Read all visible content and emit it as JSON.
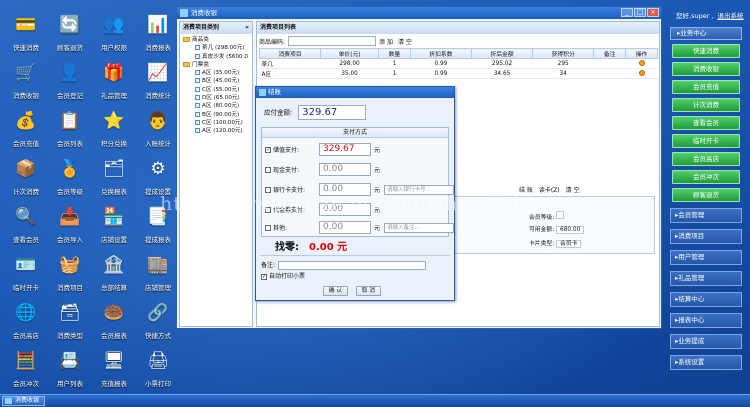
{
  "desktop": {
    "icons": [
      {
        "label": "快速消费",
        "glyph": "💳",
        "icon": "card-icon"
      },
      {
        "label": "顾客退货",
        "glyph": "🔄",
        "icon": "return-icon"
      },
      {
        "label": "用户权限",
        "glyph": "👥",
        "icon": "users-icon"
      },
      {
        "label": "消费报表",
        "glyph": "📊",
        "icon": "report-icon"
      },
      {
        "label": "消费收银",
        "glyph": "🛒",
        "icon": "cashier-icon"
      },
      {
        "label": "会员登记",
        "glyph": "👤",
        "icon": "member-register-icon"
      },
      {
        "label": "礼品管理",
        "glyph": "🎁",
        "icon": "gift-icon"
      },
      {
        "label": "消费统计",
        "glyph": "📈",
        "icon": "stats-icon"
      },
      {
        "label": "会员充值",
        "glyph": "💰",
        "icon": "recharge-icon"
      },
      {
        "label": "会员列表",
        "glyph": "📋",
        "icon": "member-list-icon"
      },
      {
        "label": "积分兑换",
        "glyph": "⭐",
        "icon": "points-icon"
      },
      {
        "label": "入账统计",
        "glyph": "👨",
        "icon": "income-icon"
      },
      {
        "label": "计次消费",
        "glyph": "📦",
        "icon": "count-icon"
      },
      {
        "label": "会员等级",
        "glyph": "🏅",
        "icon": "level-icon"
      },
      {
        "label": "兑换报表",
        "glyph": "🗂",
        "icon": "exchange-report-icon"
      },
      {
        "label": "提成设置",
        "glyph": "⚙",
        "icon": "settings-icon"
      },
      {
        "label": "查看会员",
        "glyph": "🔍",
        "icon": "view-member-icon"
      },
      {
        "label": "会员导入",
        "glyph": "📥",
        "icon": "import-icon"
      },
      {
        "label": "店铺设置",
        "glyph": "🏪",
        "icon": "shop-icon"
      },
      {
        "label": "提成报表",
        "glyph": "📑",
        "icon": "commission-icon"
      },
      {
        "label": "临时开卡",
        "glyph": "🪪",
        "icon": "temp-card-icon"
      },
      {
        "label": "消费项目",
        "glyph": "🧺",
        "icon": "items-icon"
      },
      {
        "label": "总部结算",
        "glyph": "🏦",
        "icon": "settle-icon"
      },
      {
        "label": "店铺管理",
        "glyph": "🏬",
        "icon": "shop-manage-icon"
      },
      {
        "label": "会员高店",
        "glyph": "🌐",
        "icon": "member-shop-icon"
      },
      {
        "label": "消费类型",
        "glyph": "🗃",
        "icon": "types-icon"
      },
      {
        "label": "会员报表",
        "glyph": "🍩",
        "icon": "member-report-icon"
      },
      {
        "label": "快捷方式",
        "glyph": "🔗",
        "icon": "shortcut-icon"
      },
      {
        "label": "会员冲次",
        "glyph": "🧮",
        "icon": "calc-icon"
      },
      {
        "label": "用户列表",
        "glyph": "📇",
        "icon": "user-list-icon"
      },
      {
        "label": "充值报表",
        "glyph": "🖥",
        "icon": "recharge-report-icon"
      },
      {
        "label": "小票打印",
        "glyph": "🖨",
        "icon": "printer-icon"
      }
    ]
  },
  "user_bar": {
    "greeting": "您好,super ,",
    "logout": "退出系统"
  },
  "right_menu": {
    "header": "▸业务中心",
    "items": [
      "快速消费",
      "消费收银",
      "会员充值",
      "计次消费",
      "查看会员",
      "临时开卡",
      "会员高店",
      "会员冲次",
      "顾客退货"
    ],
    "sections": [
      "▸会员管理",
      "▸消费项目",
      "▸用户管理",
      "▸礼品管理",
      "▸结算中心",
      "▸报表中心",
      "▸业务提成",
      "▸系统设置"
    ]
  },
  "window": {
    "title": "消费收银",
    "controls": [
      "_",
      "□",
      "×"
    ],
    "left_panel": {
      "title": "消费项目类别",
      "collapse": "«",
      "tree": [
        {
          "name": "商品类",
          "children": [
            "茶几 (298.00元)",
            "真皮沙发 (5600.0"
          ]
        },
        {
          "name": "门票类",
          "children": [
            "A区 (35.00元)",
            "B区 (45.00元)",
            "C区 (55.00元)",
            "D区 (65.00元)",
            "A区 (80.00元)",
            "B区 (90.00元)",
            "C区 (100.00元)",
            "A区 (120.00元)"
          ]
        }
      ]
    },
    "right_panel": {
      "title": "消费项目列表",
      "search_label": "商品编码:",
      "search_value": "",
      "add_label": "添 加",
      "clear_label": "清 空",
      "columns": [
        "消费项目",
        "单价(元)",
        "数量",
        "折扣系数",
        "折后金额",
        "获得积分",
        "备注",
        "操作"
      ],
      "rows": [
        [
          "茶几",
          "298.00",
          "1",
          "0.99",
          "295.02",
          "295",
          ""
        ],
        [
          "A区",
          "35.00",
          "1",
          "0.99",
          "34.65",
          "34",
          ""
        ]
      ]
    },
    "info": {
      "tabs": [
        "结 账",
        "读卡(Z)",
        "清 空"
      ],
      "lines": [
        {
          "label": "会员等级:",
          "value": ""
        },
        {
          "label": "可用金额:",
          "value": "680.00"
        },
        {
          "label": "卡片类型:",
          "value": "会员卡"
        }
      ]
    }
  },
  "dialog": {
    "title": "结账",
    "due_label": "应付金额:",
    "due_value": "329.67",
    "payment_header": "支付方式",
    "payments": [
      {
        "label": "储值支付:",
        "value": "329.67",
        "unit": "元",
        "checked": true,
        "extra": ""
      },
      {
        "label": "现金支付:",
        "value": "0.00",
        "unit": "元",
        "checked": false,
        "extra": ""
      },
      {
        "label": "银行卡支付:",
        "value": "0.00",
        "unit": "元",
        "checked": false,
        "extra": "请输入银行卡号..."
      },
      {
        "label": "代金券支付:",
        "value": "0.00",
        "unit": "元",
        "checked": false,
        "extra": ""
      },
      {
        "label": "其他:",
        "value": "0.00",
        "unit": "元",
        "checked": false,
        "extra": "请输入备注..."
      }
    ],
    "change_label": "找零:",
    "change_value": "0.00 元",
    "remark_label": "备注:",
    "remark_value": "",
    "print_label": "自动打印小票",
    "print_checked": true,
    "confirm": "确 认",
    "cancel": "取 消"
  },
  "watermark": "https://www.huzhan.com/ishop1012",
  "taskbar": {
    "task": "消费收银"
  }
}
